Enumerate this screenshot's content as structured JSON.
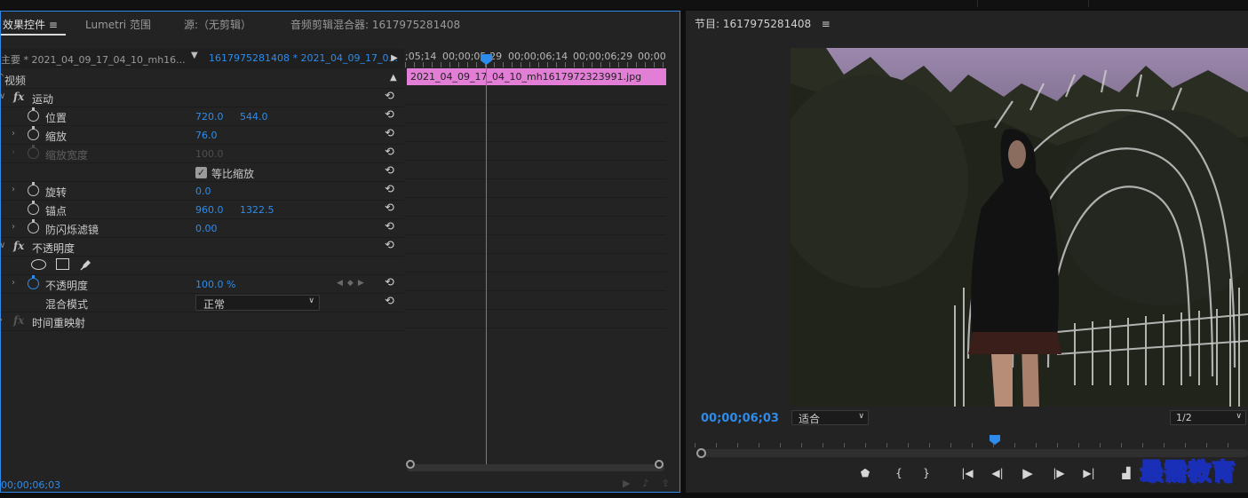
{
  "effect_controls": {
    "tabs": [
      {
        "label": "效果控件",
        "menu": "≡"
      },
      {
        "label": "Lumetri 范围"
      },
      {
        "label": "源:（无剪辑）"
      },
      {
        "label": "音频剪辑混合器: 1617975281408"
      }
    ],
    "master_label": "主要 * 2021_04_09_17_04_10_mh16...",
    "sequence_label": "1617975281408 * 2021_04_09_17_0...",
    "section_video": "视频",
    "motion": "运动",
    "position": {
      "label": "位置",
      "x": "720.0",
      "y": "544.0"
    },
    "scale": {
      "label": "缩放",
      "value": "76.0"
    },
    "scale_width": {
      "label": "缩放宽度",
      "value": "100.0"
    },
    "uniform_scale": {
      "label": "等比缩放",
      "checked": true
    },
    "rotation": {
      "label": "旋转",
      "value": "0.0"
    },
    "anchor": {
      "label": "锚点",
      "x": "960.0",
      "y": "1322.5"
    },
    "anti_flicker": {
      "label": "防闪烁滤镜",
      "value": "0.00"
    },
    "opacity_section": "不透明度",
    "opacity": {
      "label": "不透明度",
      "value": "100.0",
      "unit": "%"
    },
    "blend_mode": {
      "label": "混合模式",
      "value": "正常"
    },
    "time_remap": "时间重映射",
    "footer_timecode": "00;00;06;03",
    "timeline": {
      "ruler_labels": [
        ";05;14",
        "00;00;05;29",
        "00;00;06;14",
        "00;00;06;29",
        "00;00"
      ],
      "clip_name": "2021_04_09_17_04_10_mh1617972323991.jpg"
    }
  },
  "program_monitor": {
    "title": "节目: 1617975281408",
    "menu": "≡",
    "timecode": "00;00;06;03",
    "fit": "适合",
    "resolution": "1/2",
    "watermark": "最需教育"
  },
  "colors": {
    "accent": "#2d8ceb",
    "clip": "#e27ed6",
    "panel": "#232323"
  }
}
